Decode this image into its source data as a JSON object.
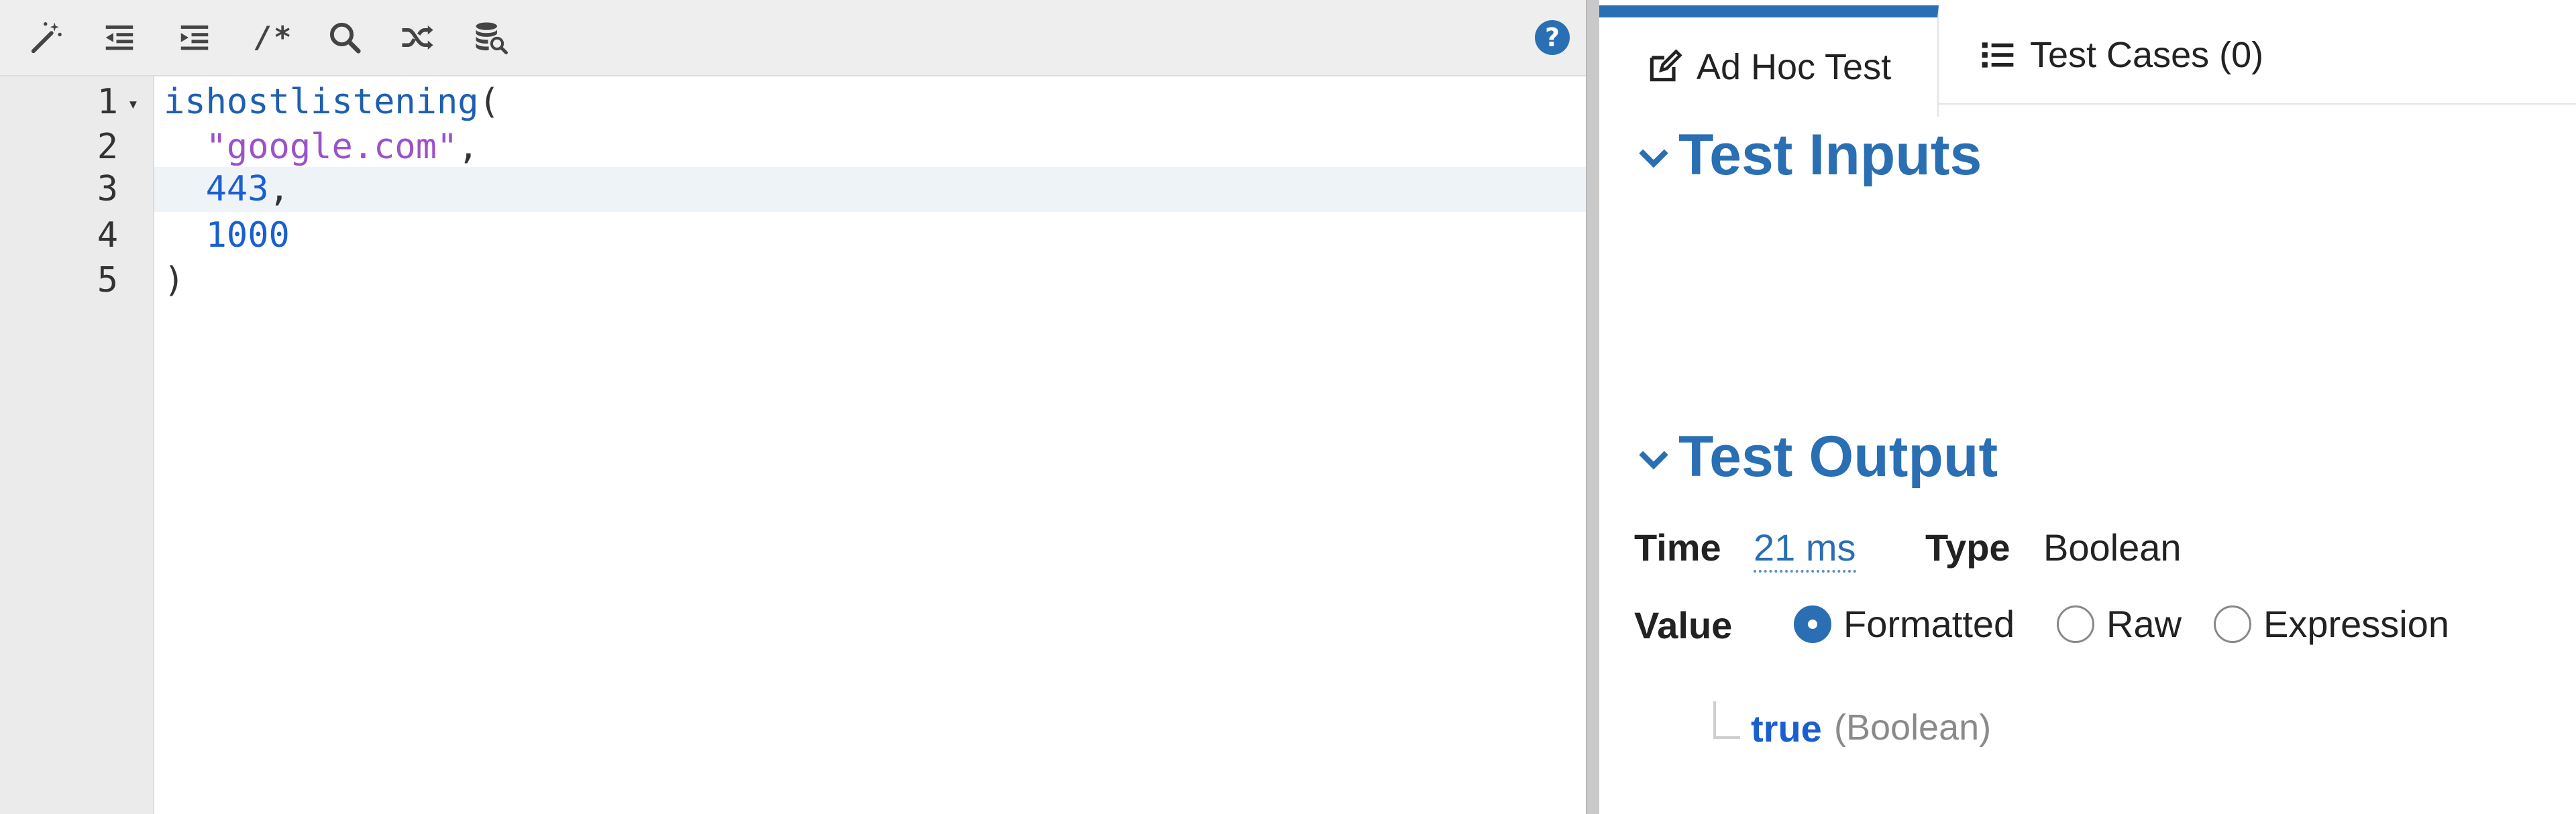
{
  "toolbar": {
    "icons": [
      "magic-wand-icon",
      "outdent-icon",
      "indent-icon",
      "comment-icon",
      "search-icon",
      "shuffle-icon",
      "database-search-icon",
      "help-icon"
    ],
    "comment_glyph": "/*",
    "help_glyph": "?"
  },
  "editor": {
    "fold_glyph": "▾",
    "lines": [
      {
        "number": "1",
        "function": "ishostlistening",
        "open": "("
      },
      {
        "number": "2",
        "string": "\"google.com\"",
        "punct": ","
      },
      {
        "number": "3",
        "number_value": "443",
        "punct": ","
      },
      {
        "number": "4",
        "number_value": "1000"
      },
      {
        "number": "5",
        "close": ")"
      }
    ]
  },
  "tabs": {
    "ad_hoc": "Ad Hoc Test",
    "test_cases": "Test Cases (0)"
  },
  "test_inputs": {
    "title": "Test Inputs"
  },
  "test_output": {
    "title": "Test Output",
    "time_label": "Time",
    "time_value": "21 ms",
    "type_label": "Type",
    "type_value": "Boolean",
    "value_label": "Value",
    "options": [
      "Formatted",
      "Raw",
      "Expression"
    ],
    "selected_option": "Formatted",
    "result_value": "true",
    "result_type": "(Boolean)"
  },
  "colors": {
    "accent": "#2a6fb3",
    "string": "#9b52c9",
    "number": "#1a5fd1",
    "active_line": "#eef3f7"
  }
}
